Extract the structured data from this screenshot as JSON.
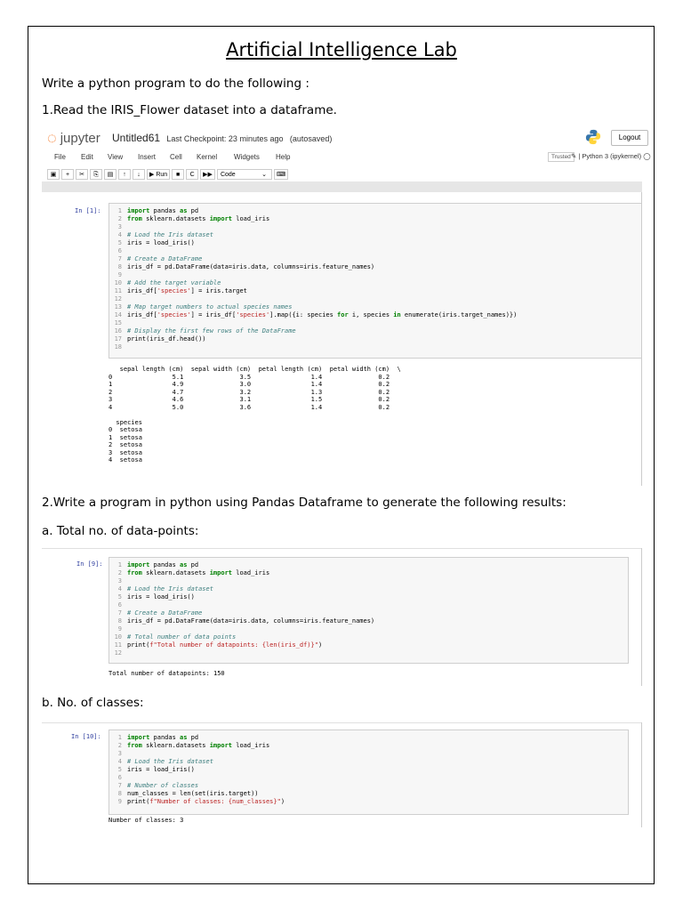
{
  "title": "Artificial Intelligence Lab",
  "intro": "Write a python program to do the following :",
  "q1": "1.Read the IRIS_Flower dataset into a dataframe.",
  "jupyter": {
    "brand": "jupyter",
    "notebook": "Untitled61",
    "checkpoint": "Last Checkpoint: 23 minutes ago",
    "autosaved": "(autosaved)",
    "logout": "Logout",
    "menu": [
      "File",
      "Edit",
      "View",
      "Insert",
      "Cell",
      "Kernel",
      "Widgets",
      "Help"
    ],
    "trusted": "Trusted",
    "kernel": "Python 3 (ipykernel)",
    "run": "Run",
    "celltype": "Code"
  },
  "cell1": {
    "prompt": "In [1]:",
    "lines": [
      {
        "n": "1",
        "html": "<span class='kw'>import</span> pandas <span class='kw'>as</span> pd"
      },
      {
        "n": "2",
        "html": "<span class='kw'>from</span> sklearn.datasets <span class='kw'>import</span> load_iris"
      },
      {
        "n": "3",
        "html": ""
      },
      {
        "n": "4",
        "html": "<span class='cm'># Load the Iris dataset</span>"
      },
      {
        "n": "5",
        "html": "iris = load_iris()"
      },
      {
        "n": "6",
        "html": ""
      },
      {
        "n": "7",
        "html": "<span class='cm'># Create a DataFrame</span>"
      },
      {
        "n": "8",
        "html": "iris_df = pd.DataFrame(data=iris.data, columns=iris.feature_names)"
      },
      {
        "n": "9",
        "html": ""
      },
      {
        "n": "10",
        "html": "<span class='cm'># Add the target variable</span>"
      },
      {
        "n": "11",
        "html": "iris_df[<span class='st'>'species'</span>] = iris.target"
      },
      {
        "n": "12",
        "html": ""
      },
      {
        "n": "13",
        "html": "<span class='cm'># Map target numbers to actual species names</span>"
      },
      {
        "n": "14",
        "html": "iris_df[<span class='st'>'species'</span>] = iris_df[<span class='st'>'species'</span>].map({i: species <span class='kw'>for</span> i, species <span class='kw'>in</span> enumerate(iris.target_names)})"
      },
      {
        "n": "15",
        "html": ""
      },
      {
        "n": "16",
        "html": "<span class='cm'># Display the first few rows of the DataFrame</span>"
      },
      {
        "n": "17",
        "html": "print(iris_df.head())"
      },
      {
        "n": "18",
        "html": ""
      }
    ],
    "output": "   sepal length (cm)  sepal width (cm)  petal length (cm)  petal width (cm)  \\\n0                5.1               3.5                1.4               0.2   \n1                4.9               3.0                1.4               0.2   \n2                4.7               3.2                1.3               0.2   \n3                4.6               3.1                1.5               0.2   \n4                5.0               3.6                1.4               0.2   \n\n  species  \n0  setosa  \n1  setosa  \n2  setosa  \n3  setosa  \n4  setosa  "
  },
  "q2": "2.Write a program in python using Pandas Dataframe to generate the following results:",
  "qa": "a. Total no. of data-points:",
  "cell2": {
    "prompt": "In [9]:",
    "lines": [
      {
        "n": "1",
        "html": "<span class='kw'>import</span> pandas <span class='kw'>as</span> pd"
      },
      {
        "n": "2",
        "html": "<span class='kw'>from</span> sklearn.datasets <span class='kw'>import</span> load_iris"
      },
      {
        "n": "3",
        "html": ""
      },
      {
        "n": "4",
        "html": "<span class='cm'># Load the Iris dataset</span>"
      },
      {
        "n": "5",
        "html": "iris = load_iris()"
      },
      {
        "n": "6",
        "html": ""
      },
      {
        "n": "7",
        "html": "<span class='cm'># Create a DataFrame</span>"
      },
      {
        "n": "8",
        "html": "iris_df = pd.DataFrame(data=iris.data, columns=iris.feature_names)"
      },
      {
        "n": "9",
        "html": ""
      },
      {
        "n": "10",
        "html": "<span class='cm'># Total number of data points</span>"
      },
      {
        "n": "11",
        "html": "print(<span class='st'>f\"Total number of datapoints: {len(iris_df)}\"</span>)"
      },
      {
        "n": "12",
        "html": ""
      }
    ],
    "output": "Total number of datapoints: 150"
  },
  "qb": "b. No. of classes:",
  "cell3": {
    "prompt": "In [10]:",
    "lines": [
      {
        "n": "1",
        "html": "<span class='kw'>import</span> pandas <span class='kw'>as</span> pd"
      },
      {
        "n": "2",
        "html": "<span class='kw'>from</span> sklearn.datasets <span class='kw'>import</span> load_iris"
      },
      {
        "n": "3",
        "html": ""
      },
      {
        "n": "4",
        "html": "<span class='cm'># Load the Iris dataset</span>"
      },
      {
        "n": "5",
        "html": "iris = load_iris()"
      },
      {
        "n": "6",
        "html": ""
      },
      {
        "n": "7",
        "html": "<span class='cm'># Number of classes</span>"
      },
      {
        "n": "8",
        "html": "num_classes = len(set(iris.target))"
      },
      {
        "n": "9",
        "html": "print(<span class='st'>f\"Number of classes: {num_classes}\"</span>)"
      }
    ],
    "output": "Number of classes: 3"
  }
}
